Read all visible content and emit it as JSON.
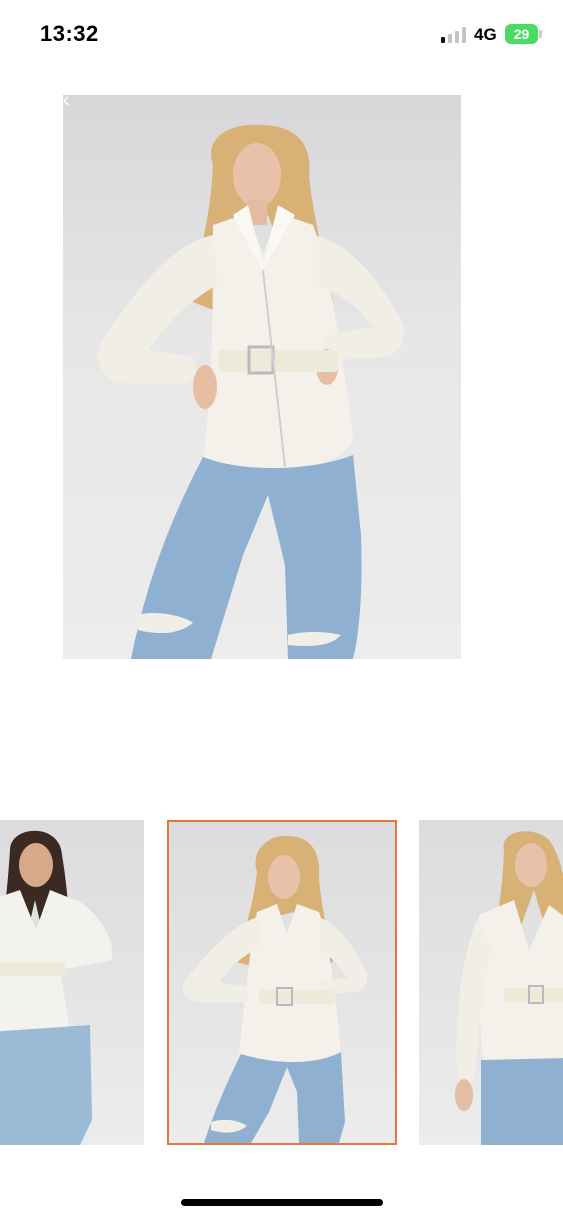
{
  "status_bar": {
    "time": "13:32",
    "network": "4G",
    "battery": "29",
    "signal_bars_active": 1,
    "signal_bars_total": 4
  },
  "gallery": {
    "main_image_icon": "model-photo-image",
    "thumbnails": [
      {
        "icon": "model-photo-brunette-thumbnail",
        "selected": false
      },
      {
        "icon": "model-photo-blonde-front-thumbnail",
        "selected": true
      },
      {
        "icon": "model-photo-blonde-side-thumbnail",
        "selected": false
      }
    ],
    "selected_border_color": "#e8773a"
  },
  "colors": {
    "battery": "#4cd964",
    "background": "#ffffff"
  }
}
